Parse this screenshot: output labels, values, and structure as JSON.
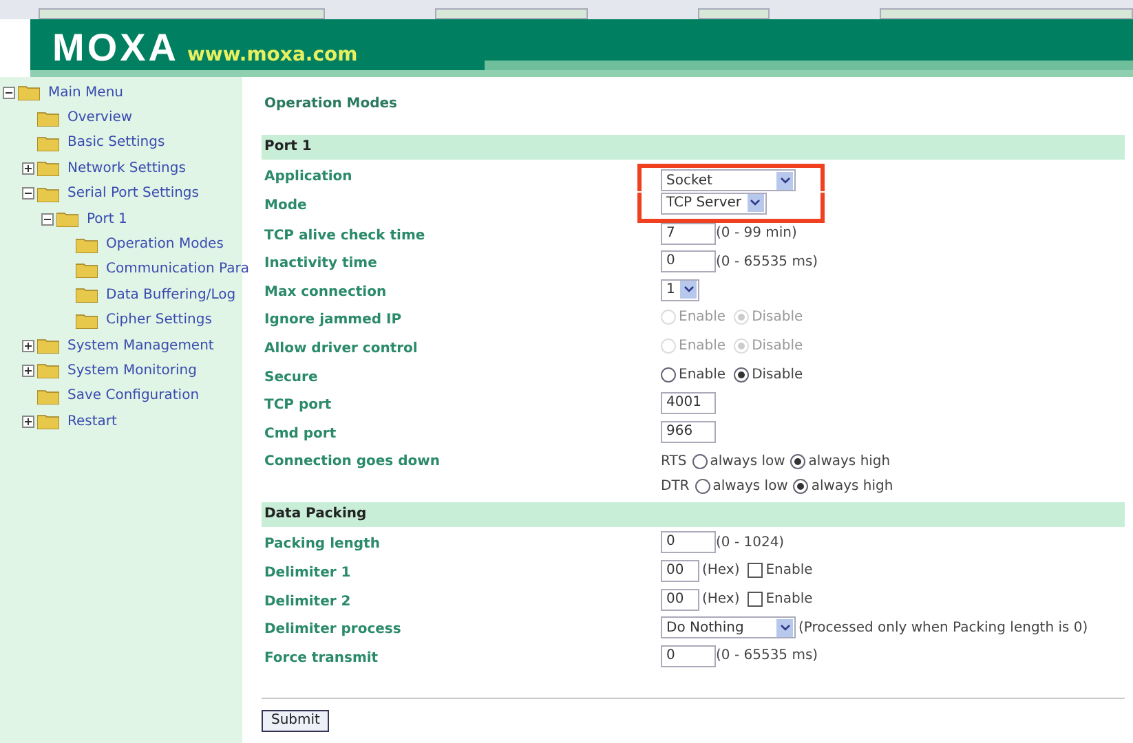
{
  "header": {
    "logo": "MOXA",
    "url": "www.moxa.com"
  },
  "menu": [
    {
      "label": "Main Menu",
      "expanded": true,
      "children": [
        {
          "label": "Overview"
        },
        {
          "label": "Basic Settings"
        },
        {
          "label": "Network Settings",
          "expanded": false
        },
        {
          "label": "Serial Port Settings",
          "expanded": true,
          "children": [
            {
              "label": "Port 1",
              "expanded": true,
              "children": [
                {
                  "label": "Operation Modes"
                },
                {
                  "label": "Communication Para"
                },
                {
                  "label": "Data Buffering/Log"
                },
                {
                  "label": "Cipher Settings"
                }
              ]
            }
          ]
        },
        {
          "label": "System Management",
          "expanded": false
        },
        {
          "label": "System Monitoring",
          "expanded": false
        },
        {
          "label": "Save Configuration"
        },
        {
          "label": "Restart",
          "expanded": false
        }
      ]
    }
  ],
  "page_title": "Operation Modes",
  "sections": [
    {
      "title": "Port 1",
      "rows": [
        {
          "kind": "select",
          "label": "Application",
          "value": "Socket",
          "wide": true,
          "highlighted": true
        },
        {
          "kind": "select",
          "label": "Mode",
          "value": "TCP Server",
          "wide": false,
          "highlighted": true
        },
        {
          "kind": "text",
          "label": "TCP alive check time",
          "value": "7",
          "hint": "(0 - 99 min)"
        },
        {
          "kind": "text",
          "label": "Inactivity time",
          "value": "0",
          "hint": "(0 - 65535 ms)"
        },
        {
          "kind": "select",
          "label": "Max connection",
          "value": "1",
          "wide": false
        },
        {
          "kind": "radio",
          "label": "Ignore jammed IP",
          "disabled": true,
          "options": [
            {
              "label": "Enable",
              "selected": false
            },
            {
              "label": "Disable",
              "selected": true
            }
          ]
        },
        {
          "kind": "radio",
          "label": "Allow driver control",
          "disabled": true,
          "options": [
            {
              "label": "Enable",
              "selected": false
            },
            {
              "label": "Disable",
              "selected": true
            }
          ]
        },
        {
          "kind": "radio",
          "label": "Secure",
          "disabled": false,
          "options": [
            {
              "label": "Enable",
              "selected": false
            },
            {
              "label": "Disable",
              "selected": true
            }
          ]
        },
        {
          "kind": "text",
          "label": "TCP port",
          "value": "4001"
        },
        {
          "kind": "text",
          "label": "Cmd port",
          "value": "966"
        },
        {
          "kind": "lines",
          "label": "Connection goes down",
          "lines": [
            {
              "name": "RTS",
              "options": [
                {
                  "label": "always low",
                  "selected": false
                },
                {
                  "label": "always high",
                  "selected": true
                }
              ]
            },
            {
              "name": "DTR",
              "options": [
                {
                  "label": "always low",
                  "selected": false
                },
                {
                  "label": "always high",
                  "selected": true
                }
              ]
            }
          ]
        }
      ]
    },
    {
      "title": "Data Packing",
      "rows": [
        {
          "kind": "text",
          "label": "Packing length",
          "value": "0",
          "hint": "(0 - 1024)"
        },
        {
          "kind": "check",
          "label": "Delimiter 1",
          "value": "00",
          "hint": "(Hex)",
          "check_label": "Enable",
          "checked": false
        },
        {
          "kind": "check",
          "label": "Delimiter 2",
          "value": "00",
          "hint": "(Hex)",
          "check_label": "Enable",
          "checked": false
        },
        {
          "kind": "select",
          "label": "Delimiter process",
          "value": "Do Nothing",
          "wide": true,
          "hint": "(Processed only when Packing length is 0)"
        },
        {
          "kind": "text",
          "label": "Force transmit",
          "value": "0",
          "hint": "(0 - 65535 ms)"
        }
      ]
    }
  ],
  "submit": "Submit"
}
